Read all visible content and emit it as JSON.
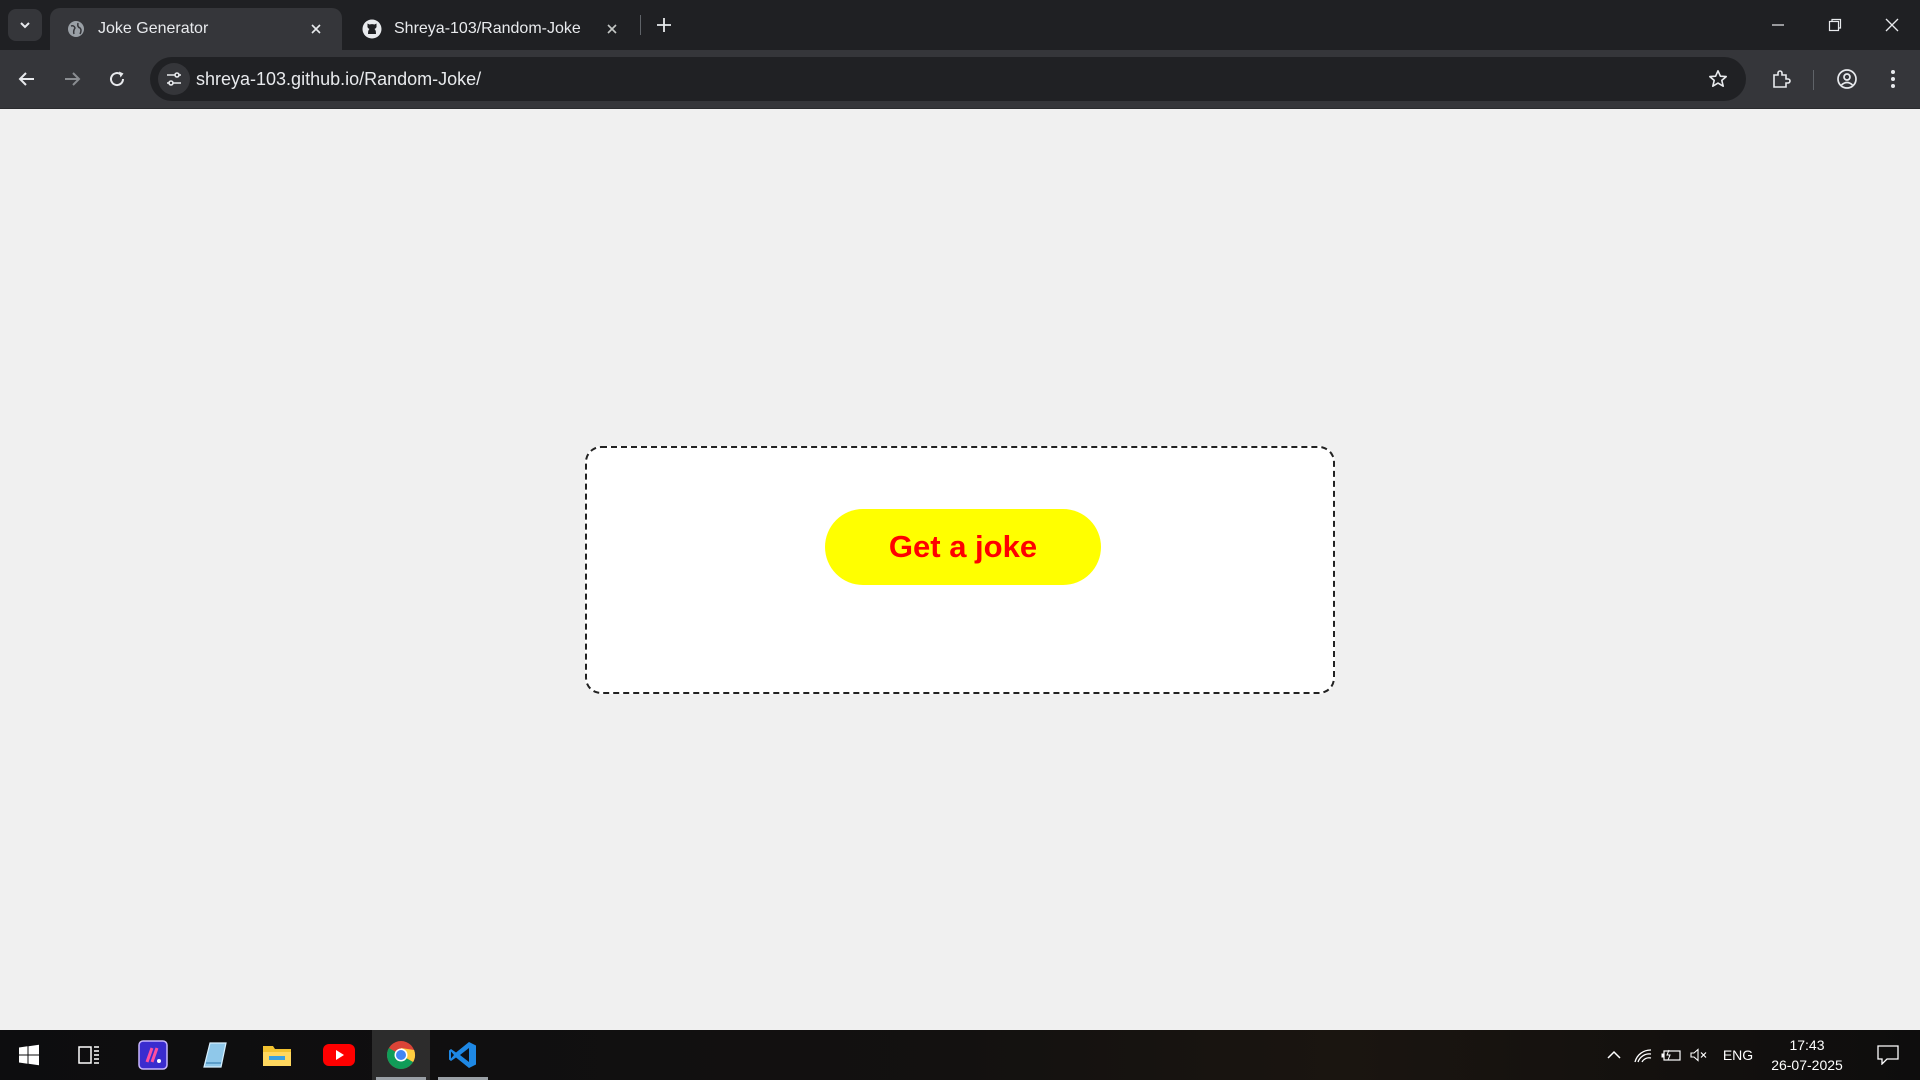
{
  "browser": {
    "tabs": [
      {
        "title": "Joke Generator",
        "active": true,
        "favicon": "globe-icon"
      },
      {
        "title": "Shreya-103/Random-Joke",
        "active": false,
        "favicon": "github-icon"
      }
    ],
    "url": "shreya-103.github.io/Random-Joke/"
  },
  "page": {
    "button_label": "Get a joke",
    "joke_text": "",
    "colors": {
      "background": "#f0f0f0",
      "card": "#ffffff",
      "button": "#ffff00",
      "button_text": "#ff0000"
    }
  },
  "taskbar": {
    "apps": [
      "start-icon",
      "task-view-icon",
      "app-icon",
      "notes-icon",
      "file-explorer-icon",
      "youtube-icon",
      "chrome-icon",
      "vscode-icon"
    ],
    "language": "ENG",
    "time": "17:43",
    "date": "26-07-2025"
  }
}
